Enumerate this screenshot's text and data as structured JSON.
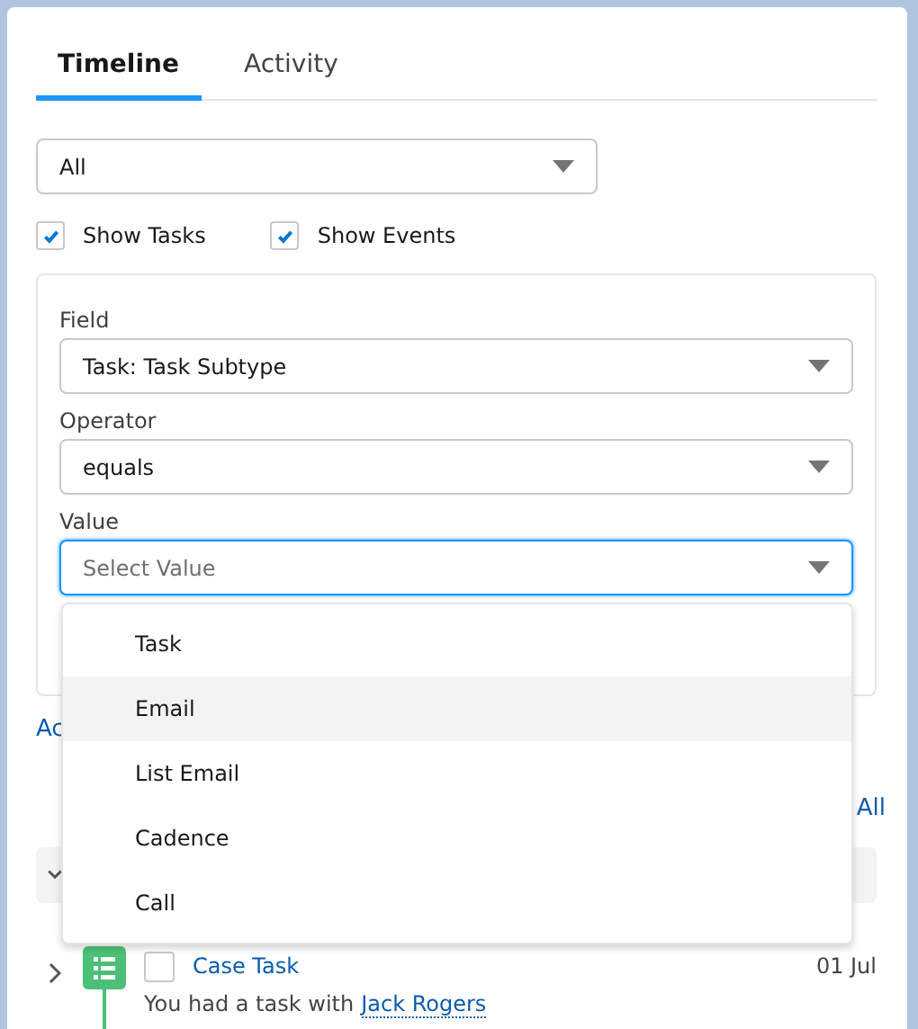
{
  "tabs": [
    {
      "label": "Timeline",
      "selected": true
    },
    {
      "label": "Activity",
      "selected": false
    }
  ],
  "view_select": {
    "value": "All"
  },
  "toggles": [
    {
      "label": "Show Tasks",
      "checked": true
    },
    {
      "label": "Show Events",
      "checked": true
    }
  ],
  "filter": {
    "fields": [
      {
        "label": "Field",
        "value": "Task: Task Subtype",
        "focused": false
      },
      {
        "label": "Operator",
        "value": "equals",
        "focused": false
      },
      {
        "label": "Value",
        "placeholder": "Select Value",
        "focused": true
      }
    ]
  },
  "dropdown_options": [
    {
      "label": "Task",
      "selected": false
    },
    {
      "label": "Email",
      "selected": true
    },
    {
      "label": "List Email",
      "selected": false
    },
    {
      "label": "Cadence",
      "selected": false
    },
    {
      "label": "Call",
      "selected": false
    }
  ],
  "add_link": "Ac",
  "view_all_link": "All",
  "timeline_items": [
    {
      "title": "Case Task",
      "date": "01 Jul",
      "checked": false,
      "description": "You had a task with",
      "contact": "Jack Rogers"
    }
  ]
}
